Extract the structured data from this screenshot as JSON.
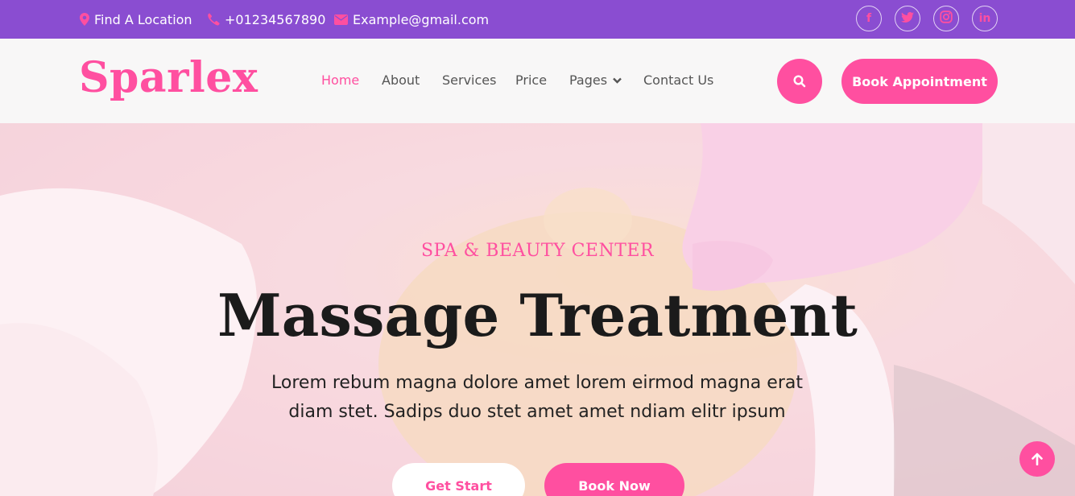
{
  "topbar": {
    "location": "Find A Location",
    "phone": "+01234567890",
    "email": "Example@gmail.com",
    "social": [
      {
        "icon": "facebook-icon",
        "glyph": "f"
      },
      {
        "icon": "twitter-icon",
        "glyph": "t"
      },
      {
        "icon": "instagram-icon",
        "glyph": "◎"
      },
      {
        "icon": "linkedin-icon",
        "glyph": "in"
      }
    ]
  },
  "nav": {
    "logo": "Sparlex",
    "links": [
      "Home",
      "About",
      "Services",
      "Price",
      "Pages",
      "Contact Us"
    ],
    "active": "Home",
    "book_label": "Book Appointment"
  },
  "hero": {
    "subtitle": "SPA & BEAUTY CENTER",
    "title": "Massage Treatment",
    "desc": "Lorem rebum magna dolore amet lorem eirmod magna erat diam stet. Sadips duo stet amet amet ndiam elitr ipsum",
    "btn_primary": "Get Start",
    "btn_secondary": "Book Now"
  },
  "colors": {
    "brand": "#ff4fa0",
    "topbar": "#8a4dd1"
  }
}
